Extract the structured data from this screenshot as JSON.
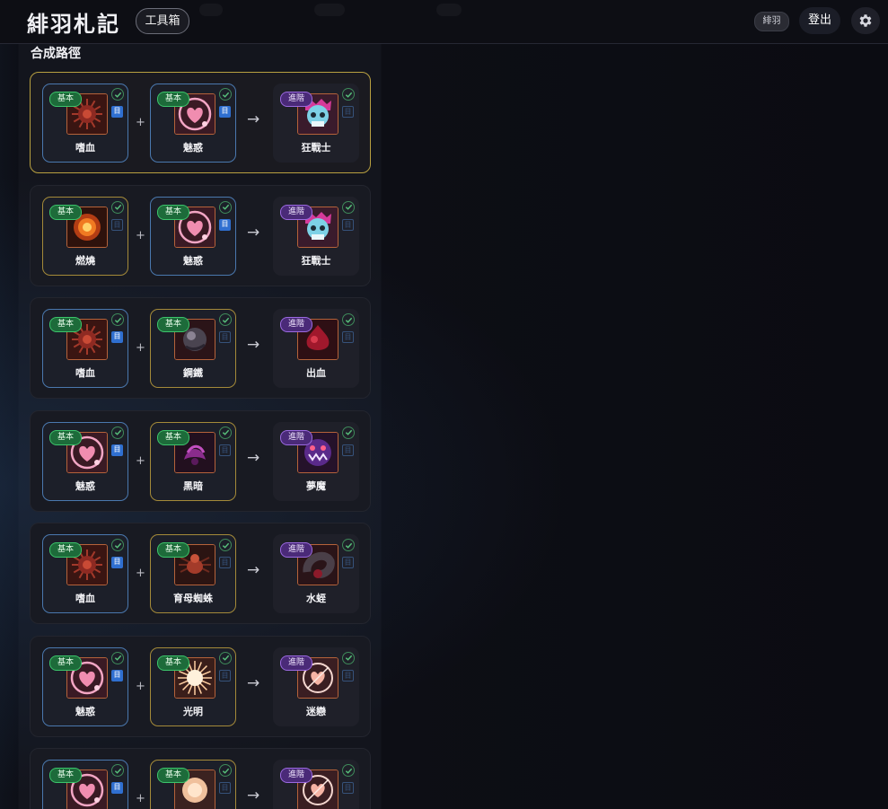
{
  "header": {
    "brand": "緋羽札記",
    "toolbox_label": "工具箱",
    "user_badge": "緋羽",
    "logout_label": "登出"
  },
  "section": {
    "title": "合成路徑"
  },
  "icons": {
    "settings": "gear-icon",
    "owned": "check-circle-icon",
    "codex": "book-icon"
  },
  "colors": {
    "basic_tag": "#1d6b3a",
    "advanced_tag": "#4a2a78",
    "highlight_border": "#b8a040",
    "codex_active": "#2f6fd0"
  },
  "tags": {
    "basic": "基本",
    "advanced": "進階"
  },
  "codex_glyph": "目",
  "recipes": [
    {
      "highlighted": true,
      "inputs": [
        {
          "name": "嗜血",
          "tag": "基本",
          "border": "blue",
          "codex": true,
          "art": "bloodthirst"
        },
        {
          "name": "魅惑",
          "tag": "基本",
          "border": "blue",
          "codex": true,
          "art": "charm"
        }
      ],
      "output": {
        "name": "狂戰士",
        "tag": "進階",
        "art": "berserker"
      }
    },
    {
      "highlighted": false,
      "inputs": [
        {
          "name": "燃燒",
          "tag": "基本",
          "border": "gold",
          "codex": false,
          "art": "burn"
        },
        {
          "name": "魅惑",
          "tag": "基本",
          "border": "blue",
          "codex": true,
          "art": "charm"
        }
      ],
      "output": {
        "name": "狂戰士",
        "tag": "進階",
        "art": "berserker"
      }
    },
    {
      "highlighted": false,
      "inputs": [
        {
          "name": "嗜血",
          "tag": "基本",
          "border": "blue",
          "codex": true,
          "art": "bloodthirst"
        },
        {
          "name": "鋼鐵",
          "tag": "基本",
          "border": "gold",
          "codex": false,
          "art": "steel"
        }
      ],
      "output": {
        "name": "出血",
        "tag": "進階",
        "art": "bleed"
      }
    },
    {
      "highlighted": false,
      "inputs": [
        {
          "name": "魅惑",
          "tag": "基本",
          "border": "blue",
          "codex": true,
          "art": "charm"
        },
        {
          "name": "黑暗",
          "tag": "基本",
          "border": "gold",
          "codex": false,
          "art": "dark"
        }
      ],
      "output": {
        "name": "夢魔",
        "tag": "進階",
        "art": "nightmare"
      }
    },
    {
      "highlighted": false,
      "inputs": [
        {
          "name": "嗜血",
          "tag": "基本",
          "border": "blue",
          "codex": true,
          "art": "bloodthirst"
        },
        {
          "name": "育母蜘蛛",
          "tag": "基本",
          "border": "gold",
          "codex": false,
          "art": "spider"
        }
      ],
      "output": {
        "name": "水蛭",
        "tag": "進階",
        "art": "leech"
      }
    },
    {
      "highlighted": false,
      "inputs": [
        {
          "name": "魅惑",
          "tag": "基本",
          "border": "blue",
          "codex": true,
          "art": "charm"
        },
        {
          "name": "光明",
          "tag": "基本",
          "border": "gold",
          "codex": false,
          "art": "light"
        }
      ],
      "output": {
        "name": "迷戀",
        "tag": "進階",
        "art": "infatuation"
      }
    },
    {
      "highlighted": false,
      "inputs": [
        {
          "name": "",
          "tag": "基本",
          "border": "blue",
          "codex": true,
          "art": "charm"
        },
        {
          "name": "",
          "tag": "基本",
          "border": "gold",
          "codex": false,
          "art": "holy"
        }
      ],
      "output": {
        "name": "",
        "tag": "進階",
        "art": "infatuation"
      }
    }
  ]
}
